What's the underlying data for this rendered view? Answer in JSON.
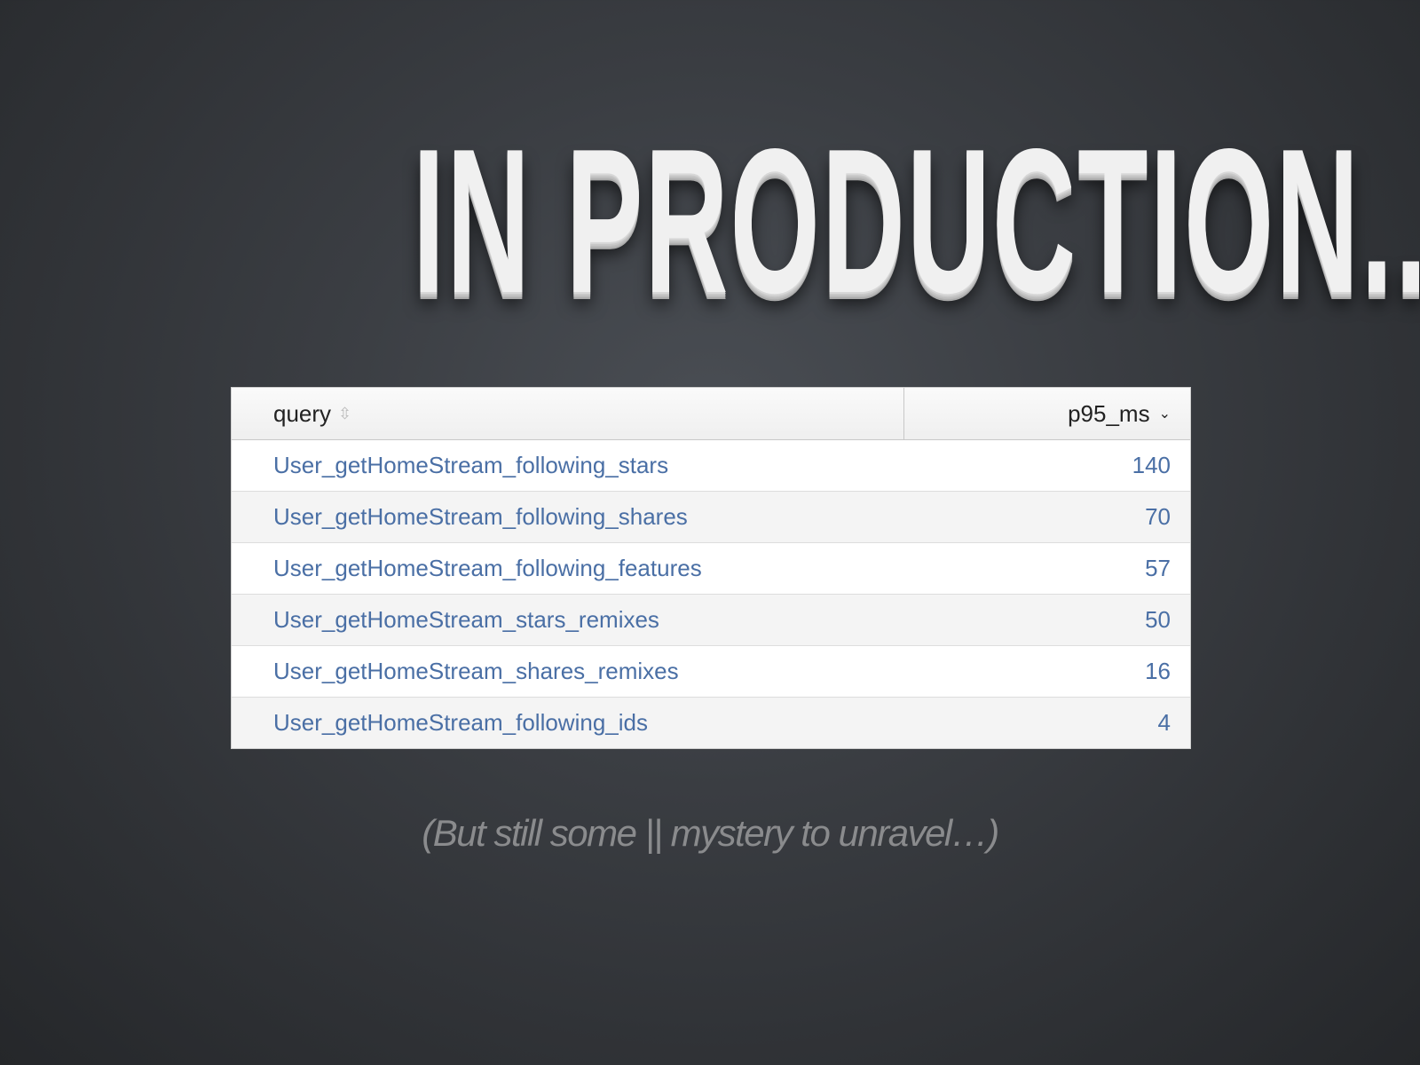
{
  "title": "IN PRODUCTION...",
  "table": {
    "headers": [
      {
        "label": "query",
        "sort_icon": "sort-both-icon"
      },
      {
        "label": "p95_ms",
        "sort_icon": "sort-desc-icon"
      }
    ],
    "rows": [
      {
        "query": "User_getHomeStream_following_stars",
        "p95_ms": "140"
      },
      {
        "query": "User_getHomeStream_following_shares",
        "p95_ms": "70"
      },
      {
        "query": "User_getHomeStream_following_features",
        "p95_ms": "57"
      },
      {
        "query": "User_getHomeStream_stars_remixes",
        "p95_ms": "50"
      },
      {
        "query": "User_getHomeStream_shares_remixes",
        "p95_ms": "16"
      },
      {
        "query": "User_getHomeStream_following_ids",
        "p95_ms": "4"
      }
    ]
  },
  "subtitle": "(But still some || mystery to unravel…)",
  "colors": {
    "link": "#4a6fa5",
    "title": "#f0f0f0",
    "background": "#3a3d42"
  }
}
